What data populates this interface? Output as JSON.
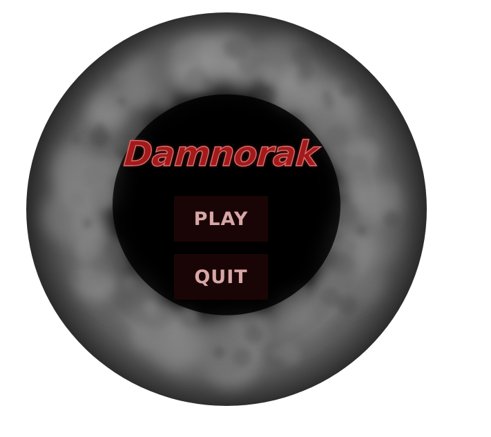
{
  "menu": {
    "title": "Damnorak",
    "play_label": "PLAY",
    "quit_label": "QUIT"
  },
  "colors": {
    "title_fill": "#a31a1a",
    "title_outline": "#e07070",
    "button_bg": "#1a0506",
    "button_text": "#d8a6a6",
    "page_bg": "#ffffff"
  }
}
